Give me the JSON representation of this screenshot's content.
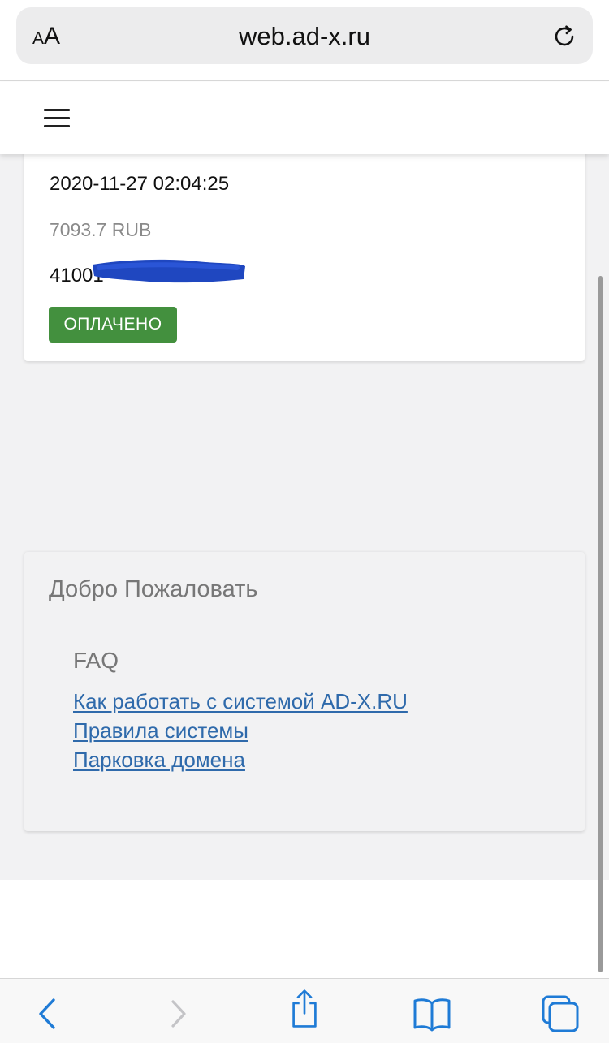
{
  "browser": {
    "aa_small": "A",
    "aa_large": "A",
    "url": "web.ad-x.ru",
    "reload_icon": "reload-icon"
  },
  "header": {
    "menu_icon": "hamburger-menu-icon"
  },
  "payment": {
    "datetime": "2020-11-27 02:04:25",
    "amount": "7093.7 RUB",
    "account_visible": "41001",
    "status": "ОПЛАЧЕНО",
    "status_color": "#43903e"
  },
  "welcome": {
    "title": "Добро Пожаловать",
    "faq_heading": "FAQ",
    "links": [
      "Как работать с системой AD-X.RU",
      "Правила системы",
      "Парковка домена"
    ],
    "link_color": "#2f6aab"
  },
  "toolbar": {
    "back_icon": "back-chevron-icon",
    "forward_icon": "forward-chevron-icon",
    "share_icon": "share-icon",
    "bookmarks_icon": "bookmarks-book-icon",
    "tabs_icon": "tabs-icon",
    "accent": "#1f7bd6"
  }
}
